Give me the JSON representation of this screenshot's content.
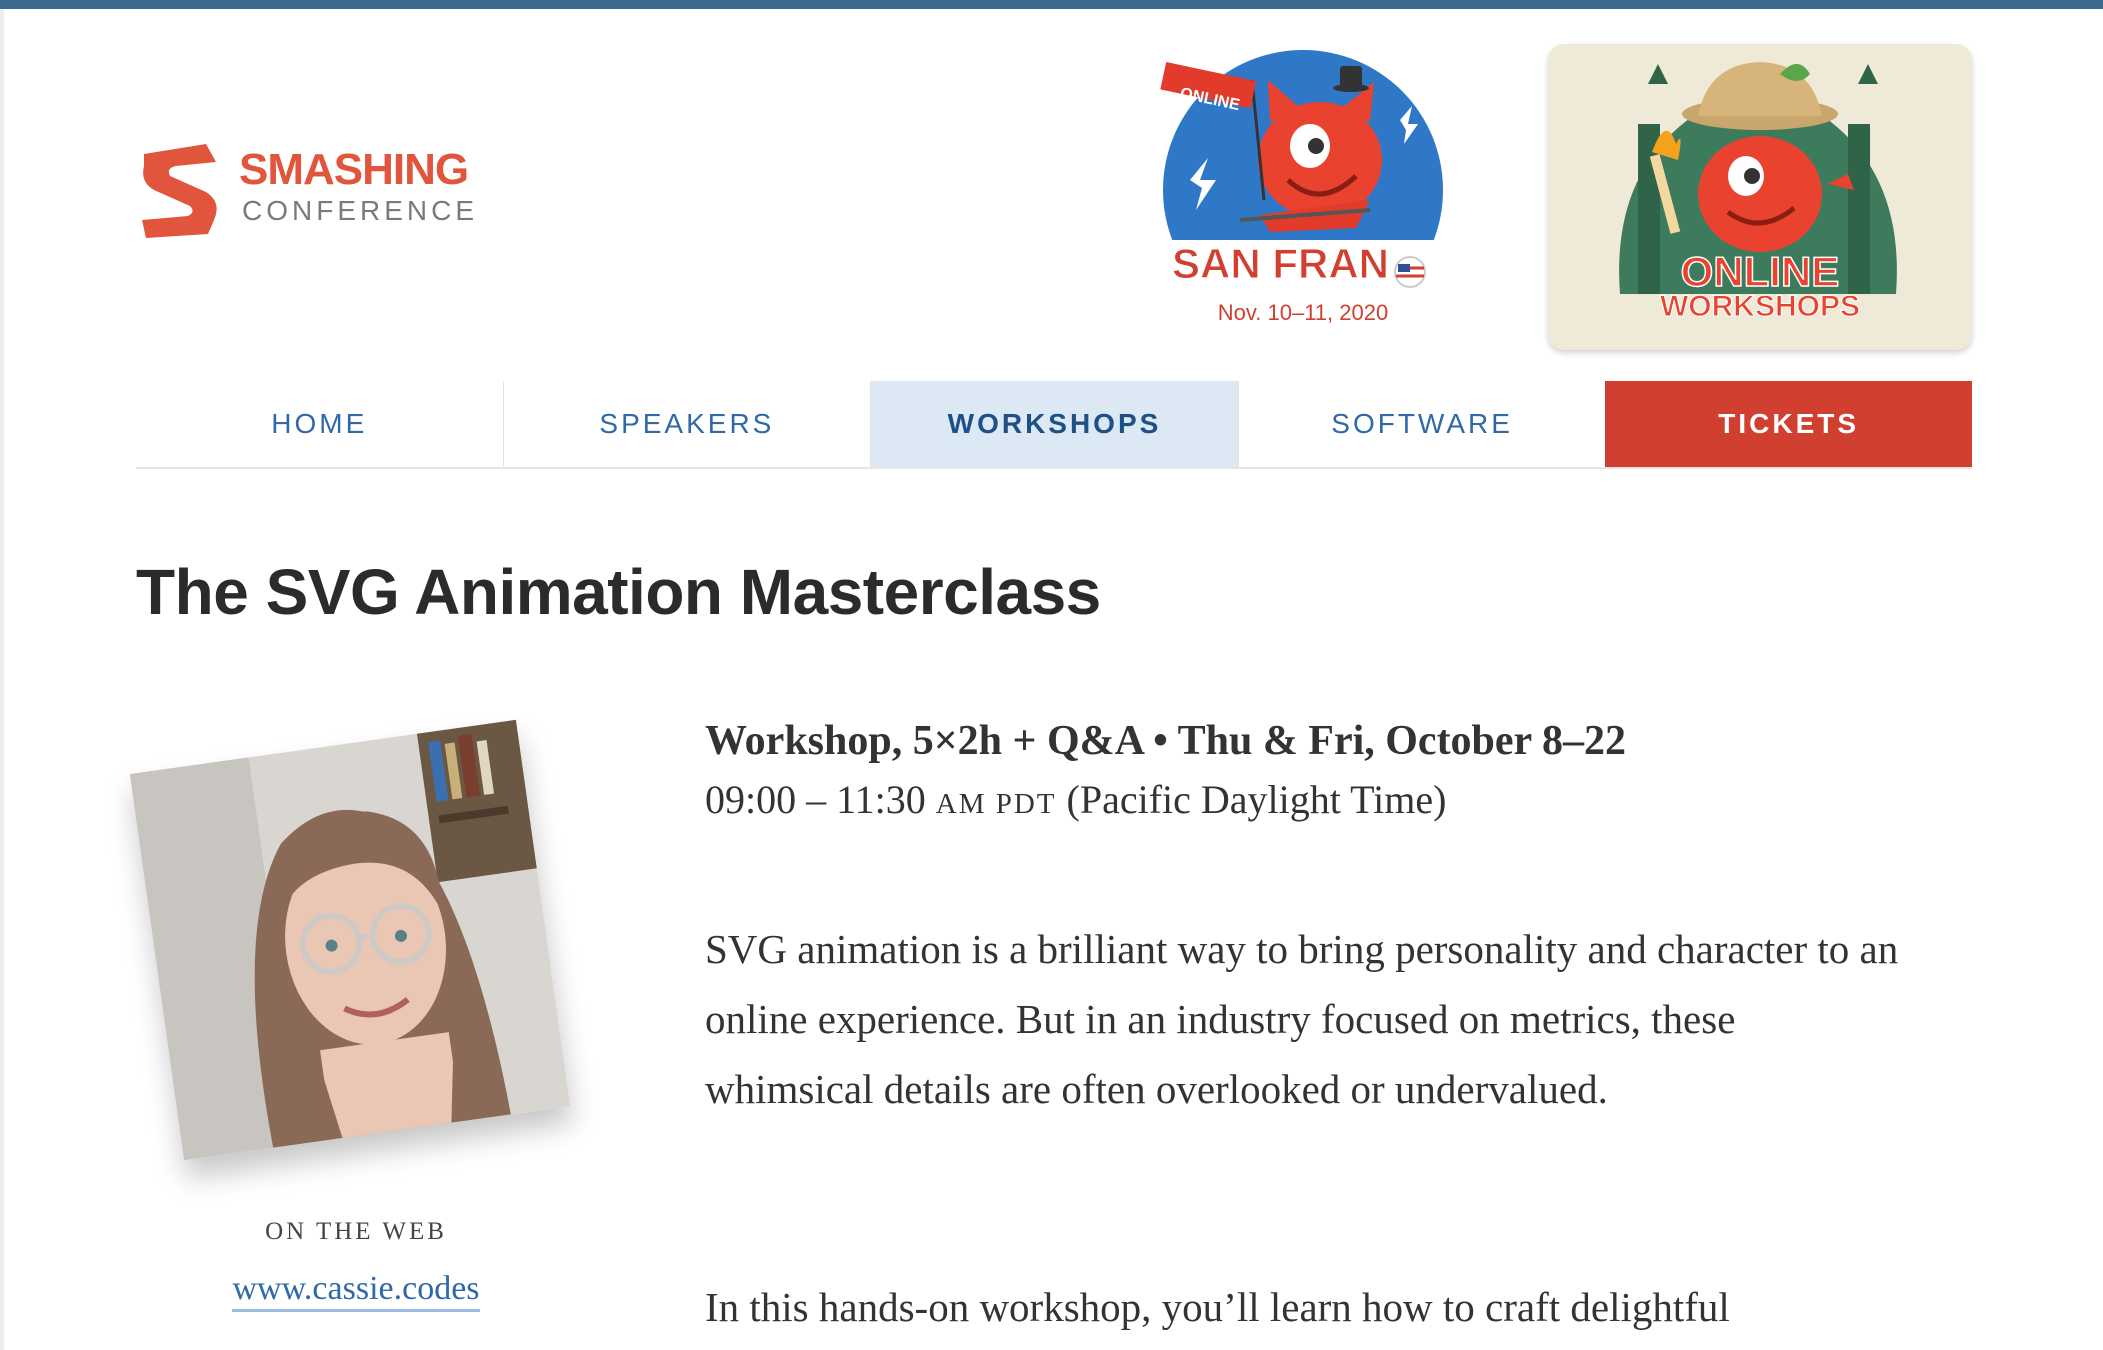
{
  "header": {
    "logo_title": "SMASHING",
    "logo_subtitle": "CONFERENCE",
    "badge_sf_flag": "ONLINE",
    "badge_sf_title": "SAN FRAN",
    "badge_sf_date": "Nov. 10–11, 2020",
    "badge_ws_line1": "ONLINE",
    "badge_ws_line2": "WORKSHOPS"
  },
  "nav": {
    "items": [
      {
        "label": "HOME"
      },
      {
        "label": "SPEAKERS"
      },
      {
        "label": "WORKSHOPS"
      },
      {
        "label": "SOFTWARE"
      },
      {
        "label": "TICKETS"
      }
    ],
    "active": "WORKSHOPS"
  },
  "page": {
    "title": "The SVG Animation Masterclass"
  },
  "speaker": {
    "web_label": "ON THE WEB",
    "web_link": "www.cassie.codes"
  },
  "workshop": {
    "meta": "Workshop, 5×2h + Q&A • Thu & Fri, October 8–22",
    "time_range": "09:00 – 11:30",
    "time_suffix": "AM PDT",
    "timezone": "(Pacific Daylight Time)",
    "paragraph1": "SVG animation is a brilliant way to bring personality and character to an online experience. But in an industry focused on metrics, these whimsical details are often overlooked or undervalued.",
    "paragraph2": "In this hands-on workshop, you’ll learn how to craft delightful"
  },
  "colors": {
    "accent_red": "#d13f31",
    "link_blue": "#2f69a7",
    "nav_active_bg": "#dce8f4",
    "top_bar": "#3e6a8e"
  }
}
